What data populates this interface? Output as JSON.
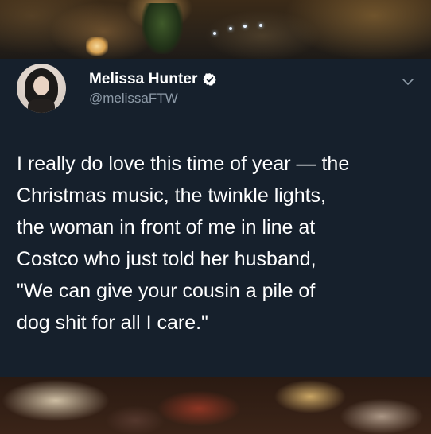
{
  "tweet": {
    "author": {
      "display_name": "Melissa Hunter",
      "handle": "@melissaFTW",
      "verified": true
    },
    "text_lines": [
      "I really do love this time of year — the",
      "Christmas music, the twinkle lights,",
      "the woman in front of me in line at",
      "Costco who just told her husband,",
      "\"We can give your cousin a pile of",
      "dog shit for all I care.\""
    ],
    "icons": {
      "verified": "verified-badge-icon",
      "menu": "chevron-down-icon"
    }
  },
  "colors": {
    "card_background": "#16202c",
    "text_primary": "#ffffff",
    "text_secondary": "#8d9aa7",
    "verified_badge": "#ffffff"
  }
}
